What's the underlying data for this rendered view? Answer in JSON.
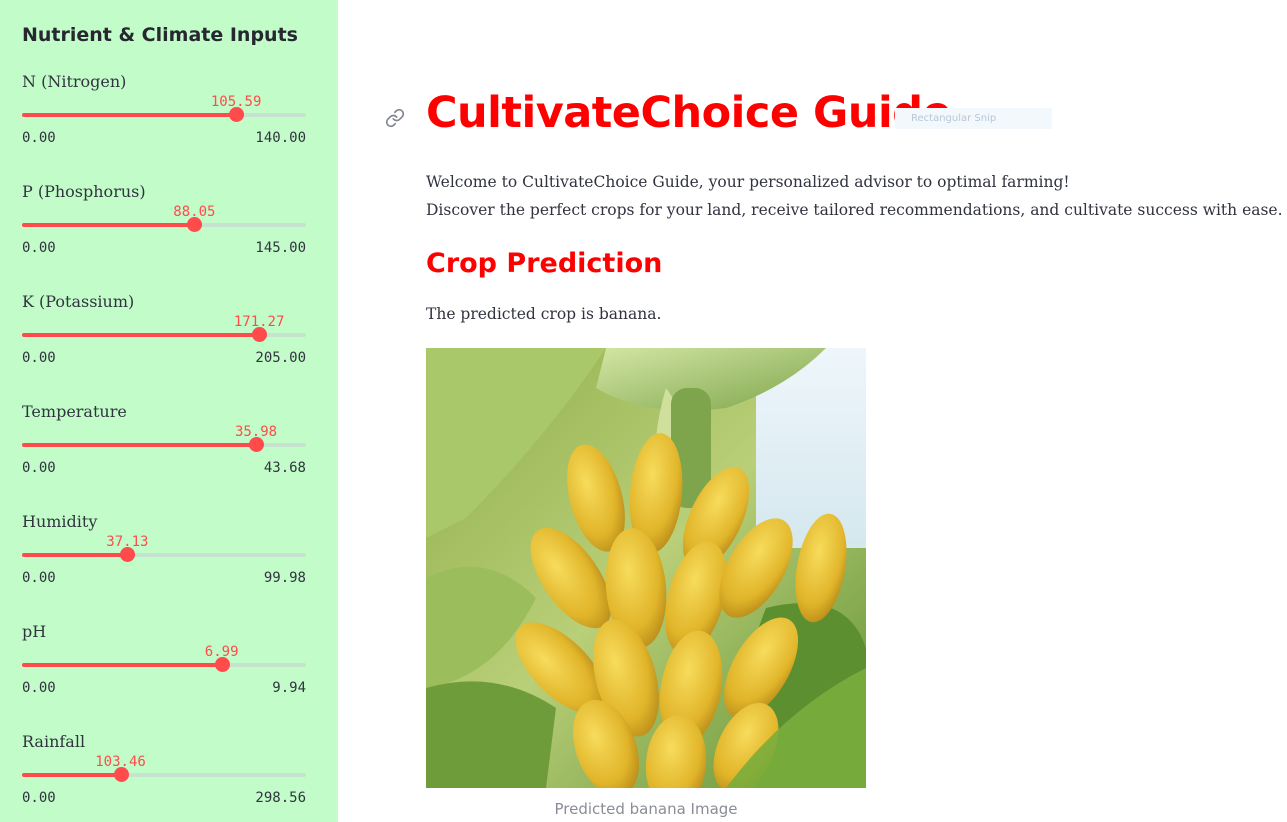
{
  "sidebar": {
    "title": "Nutrient & Climate Inputs",
    "sliders": [
      {
        "label": "N (Nitrogen)",
        "value": "105.59",
        "min": "0.00",
        "max": "140.00",
        "fraction": 0.754
      },
      {
        "label": "P (Phosphorus)",
        "value": "88.05",
        "min": "0.00",
        "max": "145.00",
        "fraction": 0.607
      },
      {
        "label": "K (Potassium)",
        "value": "171.27",
        "min": "0.00",
        "max": "205.00",
        "fraction": 0.835
      },
      {
        "label": "Temperature",
        "value": "35.98",
        "min": "0.00",
        "max": "43.68",
        "fraction": 0.824
      },
      {
        "label": "Humidity",
        "value": "37.13",
        "min": "0.00",
        "max": "99.98",
        "fraction": 0.371
      },
      {
        "label": "pH",
        "value": "6.99",
        "min": "0.00",
        "max": "9.94",
        "fraction": 0.703
      },
      {
        "label": "Rainfall",
        "value": "103.46",
        "min": "0.00",
        "max": "298.56",
        "fraction": 0.347
      }
    ]
  },
  "main": {
    "title": "CultivateChoice Guide",
    "snip_label": "Rectangular Snip",
    "intro_line1": "Welcome to CultivateChoice Guide, your personalized advisor to optimal farming!",
    "intro_line2": "Discover the perfect crops for your land, receive tailored recommendations, and cultivate success with ease.",
    "section_heading": "Crop Prediction",
    "prediction_text": "The predicted crop is banana.",
    "image_caption": "Predicted banana Image"
  },
  "colors": {
    "sidebar_bg": "#c2fdc9",
    "accent": "#ff4b4b",
    "title_red": "#ff0000",
    "track": "#c6e3d0"
  },
  "icons": {
    "anchor": "link-icon",
    "image": "banana-bunch-image"
  }
}
